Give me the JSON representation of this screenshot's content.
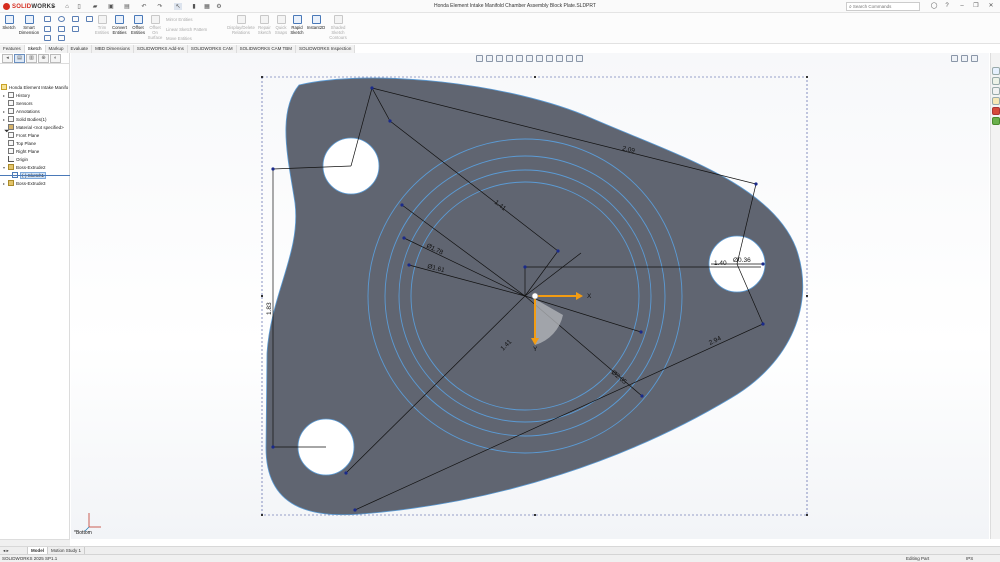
{
  "app": {
    "brand_main": "SOLID",
    "brand_sub": "WORKS",
    "document_title": "Honda Element Intake Manifold Chamber Assembly Block Plate.SLDPRT"
  },
  "search": {
    "placeholder": "Search Commands"
  },
  "ribbon": {
    "sketch": "Sketch",
    "smart_dimension": "Smart Dimension",
    "trim_entities": "Trim Entities",
    "convert_entities": "Convert Entities",
    "offset_entities": "Offset Entities",
    "offset_on_surface": "Offset On Surface",
    "mirror_entities": "Mirror Entities",
    "linear_sketch_pattern": "Linear Sketch Pattern",
    "move_entities": "Move Entities",
    "display_delete_relations": "Display/Delete Relations",
    "repair_sketch": "Repair Sketch",
    "quick_snaps": "Quick Snaps",
    "rapid_sketch": "Rapid Sketch",
    "instant2d": "Instant2D",
    "shaded_sketch_contours": "Shaded Sketch Contours"
  },
  "tabs": [
    "Features",
    "Sketch",
    "Markup",
    "Evaluate",
    "MBD Dimensions",
    "SOLIDWORKS Add-Ins",
    "SOLIDWORKS CAM",
    "SOLIDWORKS CAM TBM",
    "SOLIDWORKS Inspection"
  ],
  "active_tab": "Sketch",
  "tree": {
    "root": "Honda Element Intake Manifo",
    "history": "History",
    "sensors": "Sensors",
    "annotations": "Annotations",
    "solid_bodies": "Solid Bodies(1)",
    "material": "Material <not specified>",
    "front_plane": "Front Plane",
    "top_plane": "Top Plane",
    "right_plane": "Right Plane",
    "origin": "Origin",
    "boss_extrude2": "Boss-Extrude2",
    "sketch": "(-) Sketch1",
    "boss_extrude3": "Boss-Extrude3"
  },
  "drawing": {
    "dims": {
      "d209": "2.09",
      "d141a": "1.41",
      "d178": "Ø1.78",
      "d161": "Ø1.61",
      "d183": "1.83",
      "d140": "1.40",
      "d036": "Ø0.36",
      "d294": "2.94",
      "d141b": "1.41",
      "d205": "Ø2.05"
    },
    "axis_x": "X",
    "axis_y": "Y",
    "view_label": "*Bottom",
    "colors": {
      "part_fill": "#606571",
      "sketch_line": "#5b9bd5",
      "dim_line": "#111111",
      "axis_orange": "#f39c12"
    }
  },
  "bottom_tabs": [
    "Model",
    "Motion Study 1"
  ],
  "status": {
    "version": "SOLIDWORKS 2025 SP1.1",
    "mode": "Editing Part",
    "units": "IPS"
  }
}
